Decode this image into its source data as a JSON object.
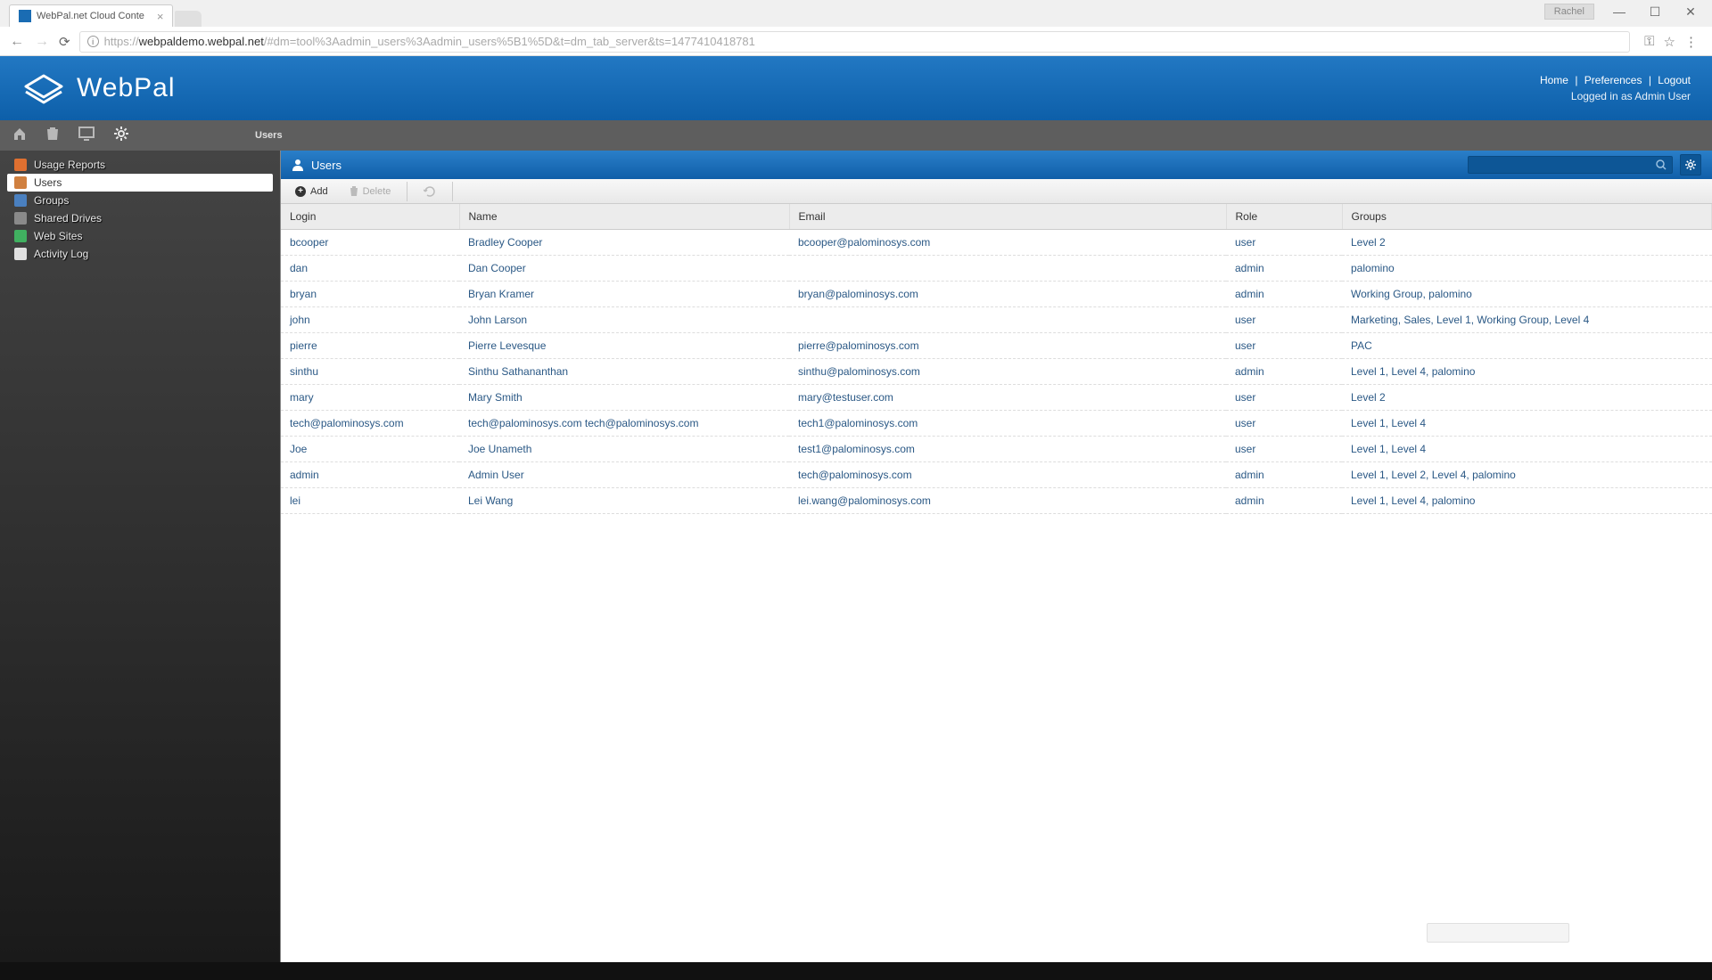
{
  "browser": {
    "tab_title": "WebPal.net Cloud Conte",
    "user_badge": "Rachel",
    "url_prefix": "https://",
    "url_domain": "webpaldemo.webpal.net",
    "url_path": "/#dm=tool%3Aadmin_users%3Aadmin_users%5B1%5D&t=dm_tab_server&ts=1477410418781"
  },
  "header": {
    "brand": "WebPal",
    "links": {
      "home": "Home",
      "preferences": "Preferences",
      "logout": "Logout"
    },
    "status": "Logged in as Admin User"
  },
  "breadcrumb": "Users",
  "sidebar": {
    "items": [
      {
        "label": "Usage Reports",
        "icon_color": "#e07030",
        "name": "sidebar-item-usage-reports"
      },
      {
        "label": "Users",
        "icon_color": "#d08040",
        "name": "sidebar-item-users",
        "active": true
      },
      {
        "label": "Groups",
        "icon_color": "#4a80c0",
        "name": "sidebar-item-groups"
      },
      {
        "label": "Shared Drives",
        "icon_color": "#8a8a8a",
        "name": "sidebar-item-shared-drives"
      },
      {
        "label": "Web Sites",
        "icon_color": "#40b060",
        "name": "sidebar-item-web-sites"
      },
      {
        "label": "Activity Log",
        "icon_color": "#e0e0e0",
        "name": "sidebar-item-activity-log"
      }
    ]
  },
  "panel": {
    "title": "Users",
    "actions": {
      "add": "Add",
      "delete": "Delete"
    },
    "columns": {
      "login": "Login",
      "name": "Name",
      "email": "Email",
      "role": "Role",
      "groups": "Groups"
    },
    "rows": [
      {
        "login": "bcooper",
        "name": "Bradley Cooper",
        "email": "bcooper@palominosys.com",
        "role": "user",
        "groups": "Level 2"
      },
      {
        "login": "dan",
        "name": "Dan Cooper",
        "email": "",
        "role": "admin",
        "groups": "palomino"
      },
      {
        "login": "bryan",
        "name": "Bryan Kramer",
        "email": "bryan@palominosys.com",
        "role": "admin",
        "groups": "Working Group, palomino"
      },
      {
        "login": "john",
        "name": "John Larson",
        "email": "",
        "role": "user",
        "groups": "Marketing, Sales, Level 1, Working Group, Level 4"
      },
      {
        "login": "pierre",
        "name": "Pierre Levesque",
        "email": "pierre@palominosys.com",
        "role": "user",
        "groups": "PAC"
      },
      {
        "login": "sinthu",
        "name": "Sinthu Sathananthan",
        "email": "sinthu@palominosys.com",
        "role": "admin",
        "groups": "Level 1, Level 4, palomino"
      },
      {
        "login": "mary",
        "name": "Mary Smith",
        "email": "mary@testuser.com",
        "role": "user",
        "groups": "Level 2"
      },
      {
        "login": "tech@palominosys.com",
        "name": "tech@palominosys.com tech@palominosys.com",
        "email": "tech1@palominosys.com",
        "role": "user",
        "groups": "Level 1, Level 4"
      },
      {
        "login": "Joe",
        "name": "Joe Unameth",
        "email": "test1@palominosys.com",
        "role": "user",
        "groups": "Level 1, Level 4"
      },
      {
        "login": "admin",
        "name": "Admin User",
        "email": "tech@palominosys.com",
        "role": "admin",
        "groups": "Level 1, Level 2, Level 4, palomino"
      },
      {
        "login": "lei",
        "name": "Lei Wang",
        "email": "lei.wang@palominosys.com",
        "role": "admin",
        "groups": "Level 1, Level 4, palomino"
      }
    ]
  }
}
